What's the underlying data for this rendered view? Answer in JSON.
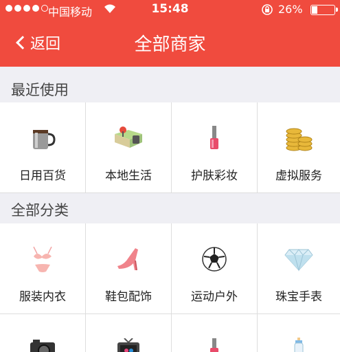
{
  "status": {
    "carrier": "中国移动",
    "time": "15:48",
    "battery_text": "26%",
    "battery_level": 0.26
  },
  "header": {
    "back_label": "返回",
    "title": "全部商家"
  },
  "recent": {
    "label": "最近使用",
    "items": [
      {
        "label": "日用百货",
        "icon": "mug-icon"
      },
      {
        "label": "本地生活",
        "icon": "map-icon"
      },
      {
        "label": "护肤彩妆",
        "icon": "nail-polish-icon"
      },
      {
        "label": "虚拟服务",
        "icon": "coins-icon"
      }
    ]
  },
  "all": {
    "label": "全部分类",
    "items": [
      {
        "label": "服装内衣",
        "icon": "lingerie-icon"
      },
      {
        "label": "鞋包配饰",
        "icon": "high-heel-icon"
      },
      {
        "label": "运动户外",
        "icon": "soccer-ball-icon"
      },
      {
        "label": "珠宝手表",
        "icon": "diamond-icon"
      },
      {
        "label": "",
        "icon": "camera-icon"
      },
      {
        "label": "",
        "icon": "tv-icon"
      },
      {
        "label": "",
        "icon": "nail-polish-icon"
      },
      {
        "label": "",
        "icon": "baby-bottle-icon"
      }
    ]
  },
  "colors": {
    "header_bg": "#f04b3e",
    "page_bg": "#efeff4"
  }
}
